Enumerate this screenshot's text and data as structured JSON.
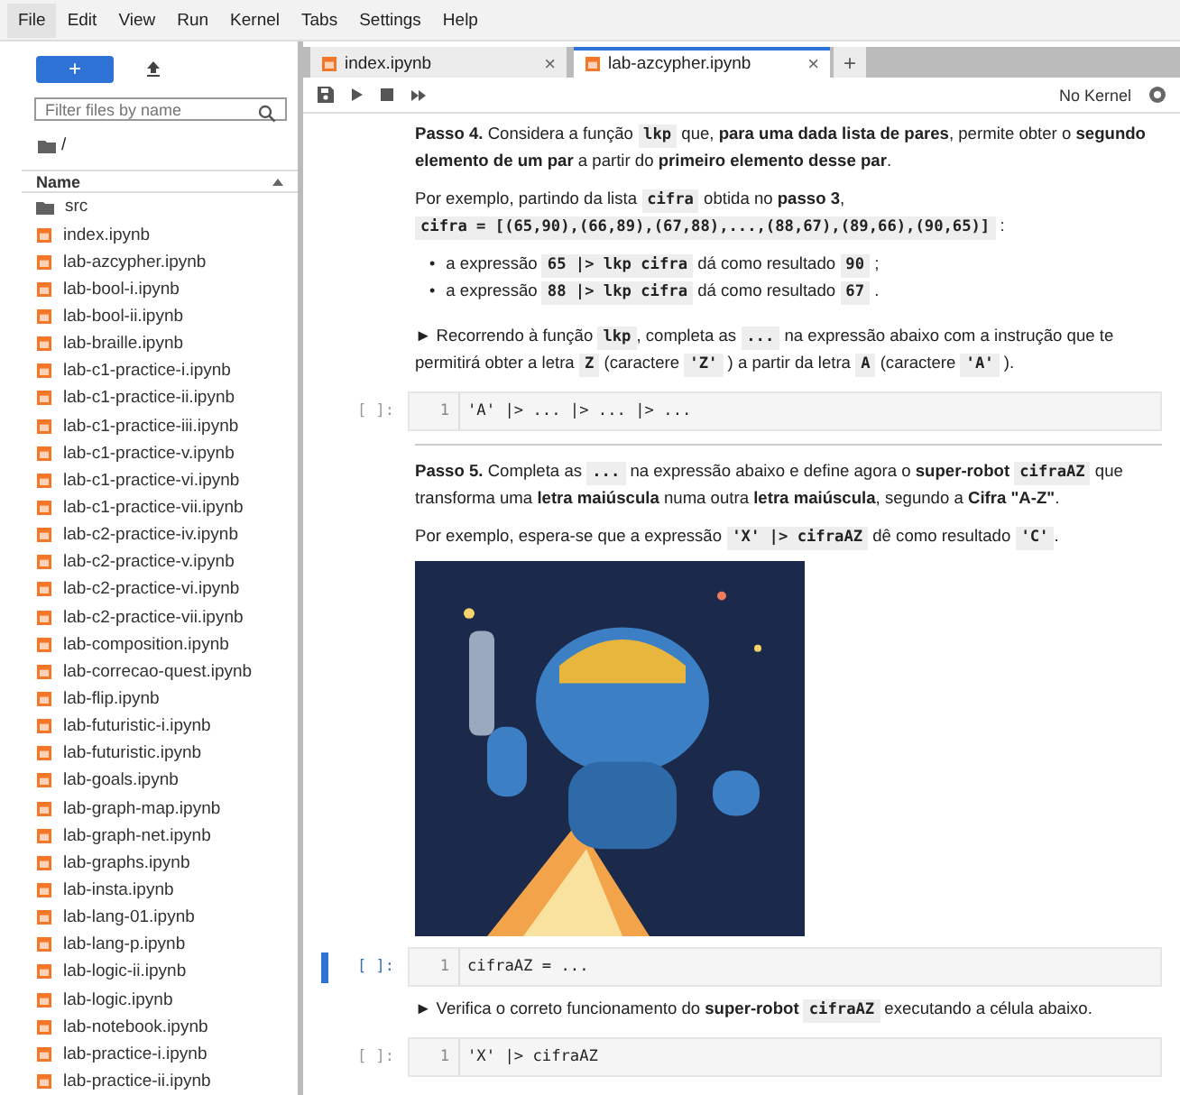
{
  "menu": [
    {
      "label": "File",
      "selected": true
    },
    {
      "label": "Edit",
      "selected": false
    },
    {
      "label": "View",
      "selected": false
    },
    {
      "label": "Run",
      "selected": false
    },
    {
      "label": "Kernel",
      "selected": false
    },
    {
      "label": "Tabs",
      "selected": false
    },
    {
      "label": "Settings",
      "selected": false
    },
    {
      "label": "Help",
      "selected": false
    }
  ],
  "sidebar": {
    "new_button": "+",
    "filter": {
      "placeholder": "Filter files by name"
    },
    "path": "/",
    "header": "Name",
    "files": [
      {
        "name": "src",
        "kind": "folder"
      },
      {
        "name": "index.ipynb",
        "kind": "notebook"
      },
      {
        "name": "lab-azcypher.ipynb",
        "kind": "notebook"
      },
      {
        "name": "lab-bool-i.ipynb",
        "kind": "notebook"
      },
      {
        "name": "lab-bool-ii.ipynb",
        "kind": "notebook"
      },
      {
        "name": "lab-braille.ipynb",
        "kind": "notebook"
      },
      {
        "name": "lab-c1-practice-i.ipynb",
        "kind": "notebook"
      },
      {
        "name": "lab-c1-practice-ii.ipynb",
        "kind": "notebook"
      },
      {
        "name": "lab-c1-practice-iii.ipynb",
        "kind": "notebook"
      },
      {
        "name": "lab-c1-practice-v.ipynb",
        "kind": "notebook"
      },
      {
        "name": "lab-c1-practice-vi.ipynb",
        "kind": "notebook"
      },
      {
        "name": "lab-c1-practice-vii.ipynb",
        "kind": "notebook"
      },
      {
        "name": "lab-c2-practice-iv.ipynb",
        "kind": "notebook"
      },
      {
        "name": "lab-c2-practice-v.ipynb",
        "kind": "notebook"
      },
      {
        "name": "lab-c2-practice-vi.ipynb",
        "kind": "notebook"
      },
      {
        "name": "lab-c2-practice-vii.ipynb",
        "kind": "notebook"
      },
      {
        "name": "lab-composition.ipynb",
        "kind": "notebook"
      },
      {
        "name": "lab-correcao-quest.ipynb",
        "kind": "notebook"
      },
      {
        "name": "lab-flip.ipynb",
        "kind": "notebook"
      },
      {
        "name": "lab-futuristic-i.ipynb",
        "kind": "notebook"
      },
      {
        "name": "lab-futuristic.ipynb",
        "kind": "notebook"
      },
      {
        "name": "lab-goals.ipynb",
        "kind": "notebook"
      },
      {
        "name": "lab-graph-map.ipynb",
        "kind": "notebook"
      },
      {
        "name": "lab-graph-net.ipynb",
        "kind": "notebook"
      },
      {
        "name": "lab-graphs.ipynb",
        "kind": "notebook"
      },
      {
        "name": "lab-insta.ipynb",
        "kind": "notebook"
      },
      {
        "name": "lab-lang-01.ipynb",
        "kind": "notebook"
      },
      {
        "name": "lab-lang-p.ipynb",
        "kind": "notebook"
      },
      {
        "name": "lab-logic-ii.ipynb",
        "kind": "notebook"
      },
      {
        "name": "lab-logic.ipynb",
        "kind": "notebook"
      },
      {
        "name": "lab-notebook.ipynb",
        "kind": "notebook"
      },
      {
        "name": "lab-practice-i.ipynb",
        "kind": "notebook"
      },
      {
        "name": "lab-practice-ii.ipynb",
        "kind": "notebook"
      }
    ]
  },
  "tabs": [
    {
      "label": "index.ipynb",
      "selected": false,
      "close": "×"
    },
    {
      "label": "lab-azcypher.ipynb",
      "selected": true,
      "close": "×"
    }
  ],
  "add_tab": "+",
  "kernel": "No Kernel",
  "cells": [
    {
      "kind": "markdown",
      "blocks": [
        {
          "kind": "paragraph",
          "segments": [
            {
              "kind": "bold",
              "text": "Passo 4."
            },
            {
              "kind": "plain",
              "text": " Considera a função "
            },
            {
              "kind": "code",
              "text": "lkp"
            },
            {
              "kind": "plain",
              "text": " que, "
            },
            {
              "kind": "bold",
              "text": "para uma dada lista de pares"
            },
            {
              "kind": "plain",
              "text": ", permite obter o "
            },
            {
              "kind": "bold",
              "text": "segundo elemento de um par"
            },
            {
              "kind": "plain",
              "text": " a partir do "
            },
            {
              "kind": "bold",
              "text": "primeiro elemento desse par"
            },
            {
              "kind": "plain",
              "text": "."
            }
          ]
        },
        {
          "kind": "paragraph",
          "segments": [
            {
              "kind": "plain",
              "text": "Por exemplo, partindo da lista "
            },
            {
              "kind": "code",
              "text": "cifra"
            },
            {
              "kind": "plain",
              "text": " obtida no "
            },
            {
              "kind": "bold",
              "text": "passo 3"
            },
            {
              "kind": "plain",
              "text": ", "
            },
            {
              "kind": "code",
              "text": "cifra = [(65,90),(66,89),(67,88),...,(88,67),(89,66),(90,65)]"
            },
            {
              "kind": "plain",
              "text": " :"
            }
          ]
        },
        {
          "kind": "bullets",
          "marker": "•",
          "items": [
            [
              {
                "kind": "plain",
                "text": "a expressão "
              },
              {
                "kind": "code",
                "text": "65 |> lkp cifra"
              },
              {
                "kind": "plain",
                "text": " dá como resultado "
              },
              {
                "kind": "code",
                "text": "90"
              },
              {
                "kind": "plain",
                "text": " ;"
              }
            ],
            [
              {
                "kind": "plain",
                "text": "a expressão "
              },
              {
                "kind": "code",
                "text": "88 |> lkp cifra"
              },
              {
                "kind": "plain",
                "text": " dá como resultado "
              },
              {
                "kind": "code",
                "text": "67"
              },
              {
                "kind": "plain",
                "text": " ."
              }
            ]
          ]
        },
        {
          "kind": "paragraph",
          "segments": [
            {
              "kind": "plain",
              "text": "► Recorrendo à função "
            },
            {
              "kind": "code",
              "text": "lkp"
            },
            {
              "kind": "plain",
              "text": ", completa as "
            },
            {
              "kind": "code",
              "text": "..."
            },
            {
              "kind": "plain",
              "text": " na expressão abaixo com a instrução que te permitirá obter a letra "
            },
            {
              "kind": "code",
              "text": "Z"
            },
            {
              "kind": "plain",
              "text": " (caractere "
            },
            {
              "kind": "code",
              "text": "'Z'"
            },
            {
              "kind": "plain",
              "text": " ) a partir da letra "
            },
            {
              "kind": "code",
              "text": "A"
            },
            {
              "kind": "plain",
              "text": " (caractere "
            },
            {
              "kind": "code",
              "text": "'A'"
            },
            {
              "kind": "plain",
              "text": " )."
            }
          ]
        }
      ]
    },
    {
      "kind": "code",
      "prompt": "[ ]:",
      "line": "1",
      "source": "'A' |> ... |> ... |> ...",
      "active": false
    },
    {
      "kind": "markdown",
      "blocks": [
        {
          "kind": "rule"
        },
        {
          "kind": "paragraph",
          "segments": [
            {
              "kind": "bold",
              "text": "Passo 5."
            },
            {
              "kind": "plain",
              "text": " Completa as "
            },
            {
              "kind": "code",
              "text": "..."
            },
            {
              "kind": "plain",
              "text": " na expressão abaixo e define agora o "
            },
            {
              "kind": "bold",
              "text": "super-robot "
            },
            {
              "kind": "code",
              "text": "cifraAZ"
            },
            {
              "kind": "plain",
              "text": " que transforma uma "
            },
            {
              "kind": "bold",
              "text": "letra maiúscula"
            },
            {
              "kind": "plain",
              "text": " numa outra "
            },
            {
              "kind": "bold",
              "text": "letra maiúscula"
            },
            {
              "kind": "plain",
              "text": ", segundo a "
            },
            {
              "kind": "bold",
              "text": "Cifra \"A-Z\""
            },
            {
              "kind": "plain",
              "text": "."
            }
          ]
        },
        {
          "kind": "paragraph",
          "segments": [
            {
              "kind": "plain",
              "text": "Por exemplo, espera-se que a expressão "
            },
            {
              "kind": "code",
              "text": "'X' |> cifraAZ"
            },
            {
              "kind": "plain",
              "text": " dê como resultado "
            },
            {
              "kind": "code",
              "text": "'C'"
            },
            {
              "kind": "plain",
              "text": "."
            }
          ]
        },
        {
          "kind": "picture"
        }
      ]
    },
    {
      "kind": "code",
      "prompt": "[ ]:",
      "line": "1",
      "source": "cifraAZ = ...",
      "active": true
    },
    {
      "kind": "markdown",
      "blocks": [
        {
          "kind": "paragraph",
          "segments": [
            {
              "kind": "plain",
              "text": "► Verifica o correto funcionamento do "
            },
            {
              "kind": "bold",
              "text": "super-robot "
            },
            {
              "kind": "code",
              "text": "cifraAZ"
            },
            {
              "kind": "plain",
              "text": " executando a célula abaixo."
            }
          ]
        }
      ]
    },
    {
      "kind": "code",
      "prompt": "[ ]:",
      "line": "1",
      "source": "'X' |> cifraAZ",
      "active": false
    }
  ]
}
